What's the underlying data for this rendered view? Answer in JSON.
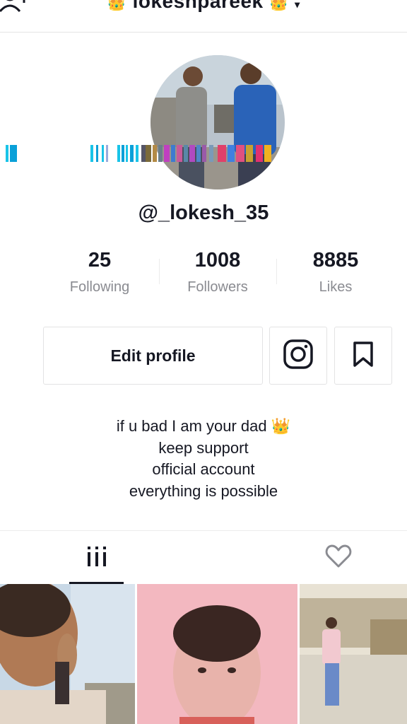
{
  "header": {
    "title": "lokeshpareek",
    "crown_left": "👑",
    "crown_right": "👑",
    "caret": "▾"
  },
  "profile": {
    "username": "@_lokesh_35",
    "stats": [
      {
        "value": "25",
        "label": "Following"
      },
      {
        "value": "1008",
        "label": "Followers"
      },
      {
        "value": "8885",
        "label": "Likes"
      }
    ],
    "edit_label": "Edit profile",
    "bio": {
      "line1": "if u bad I am your dad",
      "line1_emoji": "👑",
      "line2": "keep support",
      "line3": "official account",
      "line4": "everything is possible"
    }
  },
  "icons": {
    "add_user": "add-user-icon",
    "instagram": "instagram-icon",
    "bookmark": "bookmark-icon",
    "videos_tab": "grid-icon",
    "liked_tab": "heart-icon"
  },
  "colors": {
    "text": "#161823",
    "muted": "#8a8b91",
    "border": "#e3e3e4",
    "crown": "#f2c200"
  }
}
